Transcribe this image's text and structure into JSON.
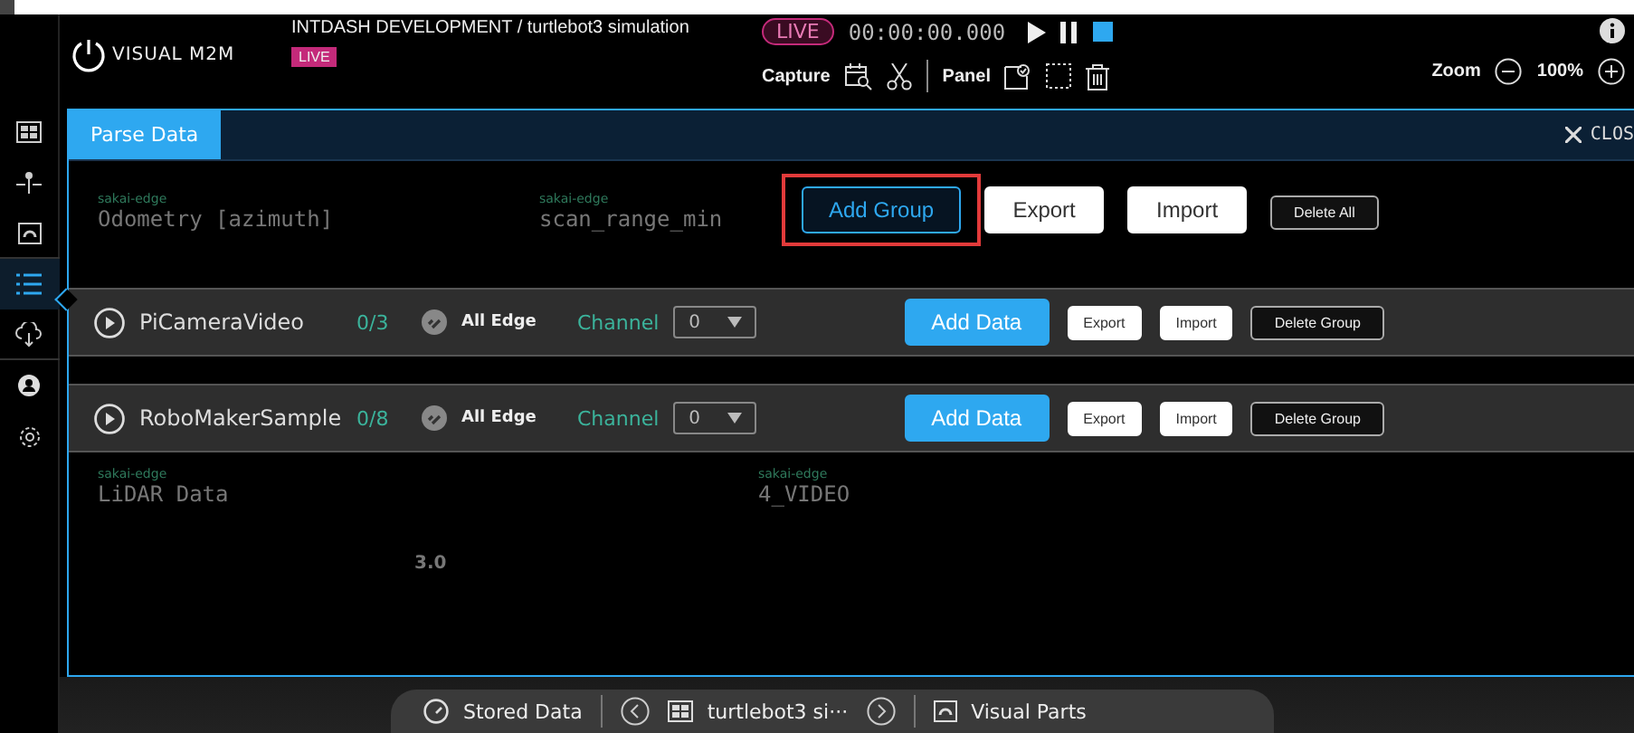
{
  "header": {
    "logo": "VISUAL M2M",
    "project_title": "INTDASH DEVELOPMENT / turtlebot3 simulation",
    "project_badge": "LIVE",
    "live_pill": "LIVE",
    "time": "00:00:00.000",
    "capture_label": "Capture",
    "panel_label": "Panel",
    "zoom_label": "Zoom",
    "zoom_value": "100%"
  },
  "sidebar": {
    "items": [
      {
        "selected": false
      },
      {
        "selected": false
      },
      {
        "selected": false
      },
      {
        "selected": true
      },
      {
        "selected": false
      },
      {
        "selected": false
      },
      {
        "selected": false
      }
    ]
  },
  "background_cards": [
    {
      "edge": "sakai-edge",
      "name": "Odometry [azimuth]"
    },
    {
      "edge": "sakai-edge",
      "name": "scan_range_min"
    },
    {
      "edge": "sakai-edge",
      "name": "LiDAR Data"
    },
    {
      "edge": "sakai-edge",
      "name": "4_VIDEO"
    }
  ],
  "background_gauge_label": "3.0",
  "modal": {
    "title": "Parse Data",
    "close": "CLOS",
    "actions": [
      {
        "label": "Add Group",
        "kind": "outline",
        "highlighted": true
      },
      {
        "label": "Export",
        "kind": "white",
        "highlighted": false
      },
      {
        "label": "Import",
        "kind": "white",
        "highlighted": false
      },
      {
        "label": "Delete All",
        "kind": "dark",
        "highlighted": false
      }
    ],
    "groups": [
      {
        "name": "PiCameraVideo",
        "count": "0/3",
        "edge": "All Edge",
        "channel_label": "Channel",
        "channel": "0",
        "buttons": [
          {
            "label": "Add Data",
            "kind": "primary"
          },
          {
            "label": "Export",
            "kind": "white"
          },
          {
            "label": "Import",
            "kind": "white"
          },
          {
            "label": "Delete Group",
            "kind": "dark"
          }
        ]
      },
      {
        "name": "RoboMakerSample",
        "count": "0/8",
        "edge": "All Edge",
        "channel_label": "Channel",
        "channel": "0",
        "buttons": [
          {
            "label": "Add Data",
            "kind": "primary"
          },
          {
            "label": "Export",
            "kind": "white"
          },
          {
            "label": "Import",
            "kind": "white"
          },
          {
            "label": "Delete Group",
            "kind": "dark"
          }
        ]
      }
    ]
  },
  "bottom_bar": {
    "stored": "Stored Data",
    "project": "turtlebot3 si···",
    "parts": "Visual Parts"
  }
}
